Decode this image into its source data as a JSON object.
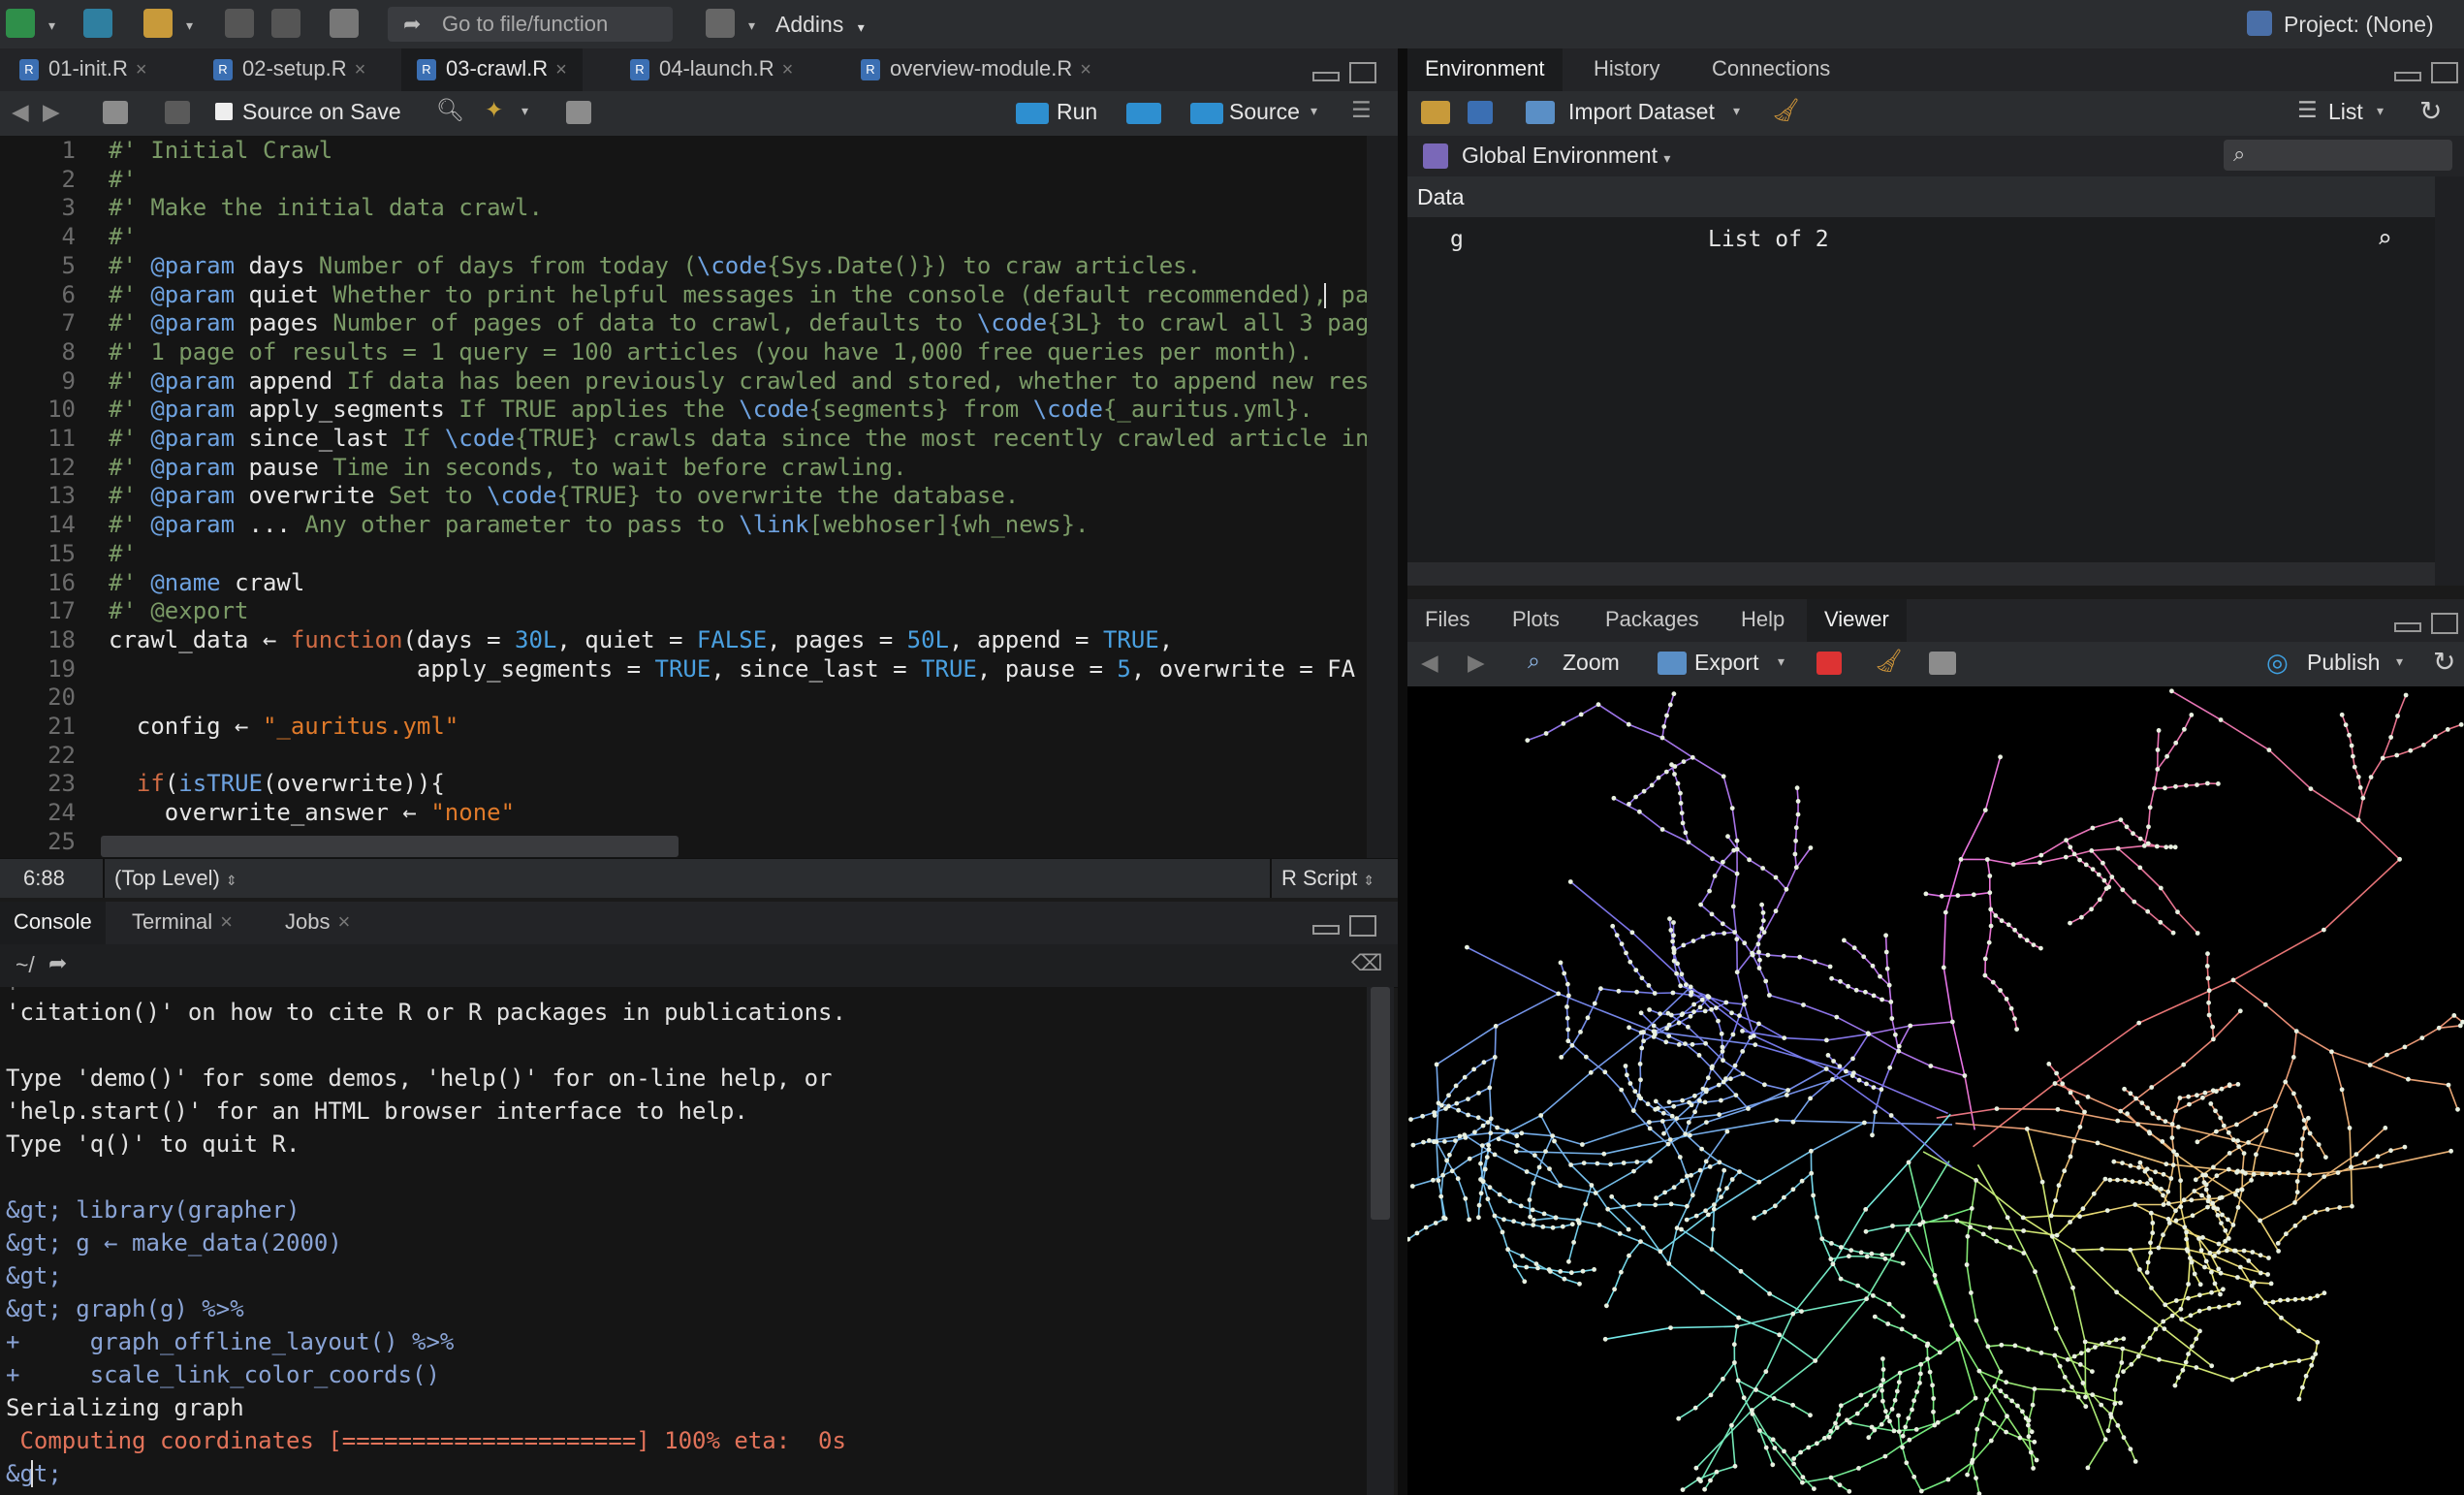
{
  "toolbar": {
    "goto_placeholder": "Go to file/function",
    "addins_label": "Addins",
    "project_label": "Project: (None)"
  },
  "editor": {
    "tabs": [
      {
        "label": "01-init.R"
      },
      {
        "label": "02-setup.R"
      },
      {
        "label": "03-crawl.R"
      },
      {
        "label": "04-launch.R"
      },
      {
        "label": "overview-module.R"
      }
    ],
    "toolbar": {
      "source_on_save": "Source on Save",
      "run": "Run",
      "source": "Source"
    },
    "status": {
      "position": "6:88",
      "scope": "(Top Level)",
      "filetype": "R Script"
    }
  },
  "console": {
    "tabs": [
      {
        "label": "Console"
      },
      {
        "label": "Terminal"
      },
      {
        "label": "Jobs"
      }
    ],
    "path": "~/",
    "lines": [
      "'citation()' on how to cite R or R packages in publications.",
      "",
      "Type 'demo()' for some demos, 'help()' for on-line help, or",
      "'help.start()' for an HTML browser interface to help.",
      "Type 'q()' to quit R.",
      "",
      "> library(grapher)",
      "> g ← make_data(2000)",
      ">",
      "> graph(g) %>%",
      "+     graph_offline_layout() %>%",
      "+     scale_link_color_coords()",
      "Serializing graph",
      " Computing coordinates [=====================] 100% eta:  0s",
      "> "
    ]
  },
  "environment": {
    "tabs": [
      {
        "label": "Environment"
      },
      {
        "label": "History"
      },
      {
        "label": "Connections"
      }
    ],
    "toolbar": {
      "import_dataset": "Import Dataset",
      "view_mode": "List"
    },
    "scope": "Global Environment",
    "section": "Data",
    "rows": [
      {
        "name": "g",
        "value": "List of 2"
      }
    ]
  },
  "files_pane": {
    "tabs": [
      {
        "label": "Files"
      },
      {
        "label": "Plots"
      },
      {
        "label": "Packages"
      },
      {
        "label": "Help"
      },
      {
        "label": "Viewer"
      }
    ],
    "toolbar": {
      "zoom": "Zoom",
      "export": "Export",
      "publish": "Publish"
    }
  },
  "code_lines": [
    "#' Initial Crawl",
    "#'",
    "#' Make the initial data crawl.",
    "#'",
    "#' @param days Number of days from today (\\code{Sys.Date()}) to craw articles.",
    "#' @param quiet Whether to print helpful messages in the console (default recommended), pa",
    "#' @param pages Number of pages of data to crawl, defaults to \\code{3L} to crawl all 3 pag",
    "#' 1 page of results = 1 query = 100 articles (you have 1,000 free queries per month).",
    "#' @param append If data has been previously crawled and stored, whether to append new res",
    "#' @param apply_segments If TRUE applies the \\code{segments} from \\code{_auritus.yml}.",
    "#' @param since_last If \\code{TRUE} crawls data since the most recently crawled article in",
    "#' @param pause Time in seconds, to wait before crawling.",
    "#' @param overwrite Set to \\code{TRUE} to overwrite the database.",
    "#' @param ... Any other parameter to pass to \\link[webhoser]{wh_news}.",
    "#'",
    "#' @name crawl",
    "#' @export",
    "crawl_data ← function(days = 30L, quiet = FALSE, pages = 50L, append = TRUE,",
    "                      apply_segments = TRUE, since_last = TRUE, pause = 5, overwrite = FA",
    "",
    "  config ← \"_auritus.yml\"",
    "",
    "  if(isTRUE(overwrite)){",
    "    overwrite_answer ← \"none\"",
    ""
  ]
}
